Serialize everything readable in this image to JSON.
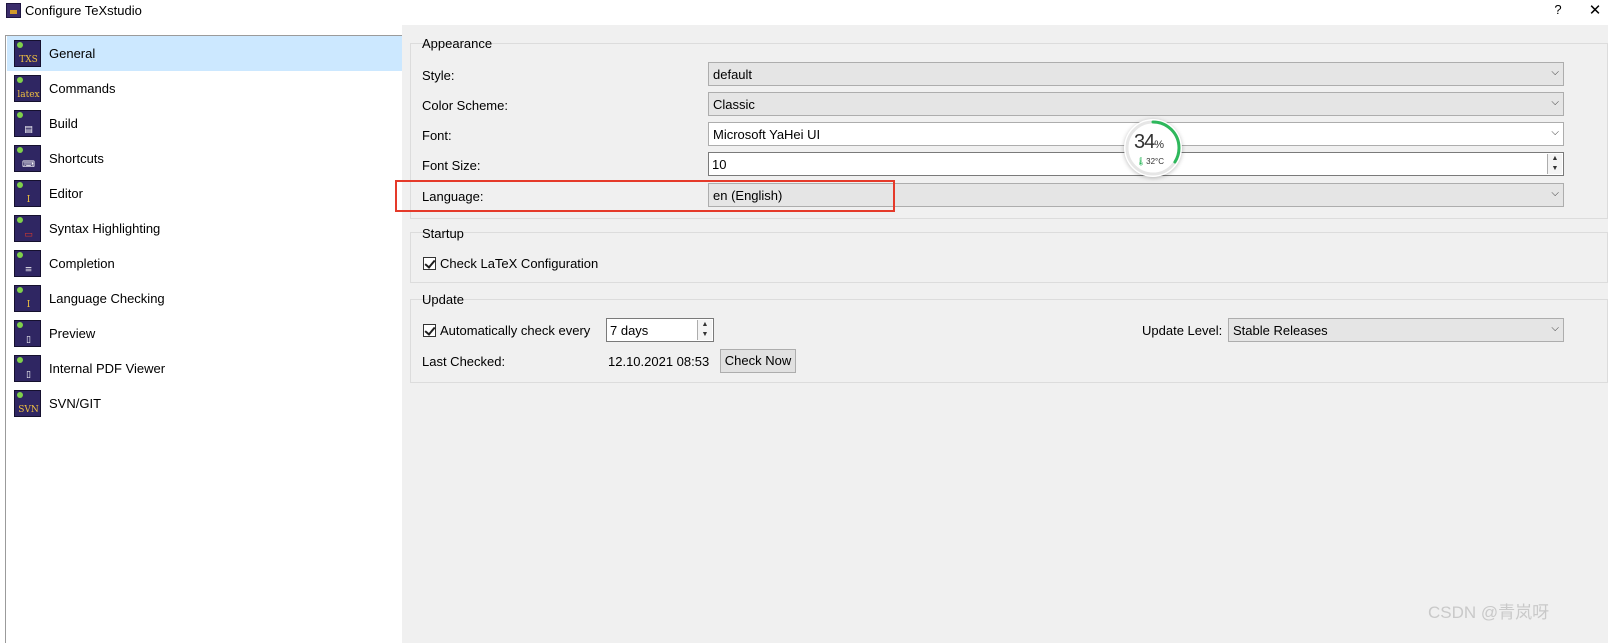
{
  "window": {
    "title": "Configure TeXstudio",
    "help": "?",
    "close": "✕"
  },
  "sidebar": {
    "items": [
      {
        "label": "General",
        "icon": "txs-icon",
        "glyph": "TXS"
      },
      {
        "label": "Commands",
        "icon": "latex-icon",
        "glyph": "latex"
      },
      {
        "label": "Build",
        "icon": "build-icon",
        "glyph": "▤"
      },
      {
        "label": "Shortcuts",
        "icon": "keyboard-icon",
        "glyph": "⌨"
      },
      {
        "label": "Editor",
        "icon": "text-cursor-icon",
        "glyph": "I"
      },
      {
        "label": "Syntax Highlighting",
        "icon": "highlight-icon",
        "glyph": "▭"
      },
      {
        "label": "Completion",
        "icon": "completion-icon",
        "glyph": "≡"
      },
      {
        "label": "Language Checking",
        "icon": "spellcheck-icon",
        "glyph": "I"
      },
      {
        "label": "Preview",
        "icon": "preview-icon",
        "glyph": "▯"
      },
      {
        "label": "Internal PDF Viewer",
        "icon": "pdf-viewer-icon",
        "glyph": "▯"
      },
      {
        "label": "SVN/GIT",
        "icon": "svn-icon",
        "glyph": "SVN"
      }
    ],
    "selected": "General"
  },
  "appearance": {
    "title": "Appearance",
    "style_label": "Style:",
    "style_value": "default",
    "color_scheme_label": "Color Scheme:",
    "color_scheme_value": "Classic",
    "font_label": "Font:",
    "font_value": "Microsoft YaHei UI",
    "font_size_label": "Font Size:",
    "font_size_value": "10",
    "language_label": "Language:",
    "language_value": "en  (English)"
  },
  "startup": {
    "title": "Startup",
    "check_latex_label": "Check LaTeX Configuration",
    "check_latex_checked": true
  },
  "update": {
    "title": "Update",
    "auto_check_label": "Automatically check every",
    "auto_check_checked": true,
    "interval_value": "7 days",
    "update_level_label": "Update Level:",
    "update_level_value": "Stable Releases",
    "last_checked_label": "Last Checked:",
    "last_checked_value": "12.10.2021 08:53",
    "check_now_label": "Check Now"
  },
  "widget": {
    "percent": "34",
    "percent_sign": "%",
    "temperature": "32°C",
    "percent_value": 0.34
  },
  "watermark": "CSDN @青岚呀",
  "colors": {
    "selection": "#cce8ff",
    "highlight_border": "#e53a2a",
    "widget_ring": "#2eb85c"
  }
}
